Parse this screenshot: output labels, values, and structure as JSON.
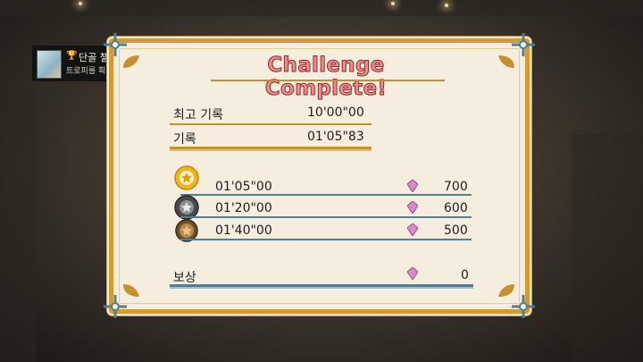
{
  "notification": {
    "trophy_name": "단골 챌린저",
    "message": "트로피를 획득했습니다!",
    "platform_badge": "PS"
  },
  "panel": {
    "title": "Challenge Complete!",
    "best_record": {
      "label": "최고 기록",
      "value": "10'00\"00"
    },
    "record": {
      "label": "기록",
      "value": "01'05\"83"
    },
    "rank_rows": [
      {
        "medal": "gold-medal-icon",
        "time": "01'05\"00",
        "gems": "700"
      },
      {
        "medal": "silver-medal-icon",
        "time": "01'20\"00",
        "gems": "600"
      },
      {
        "medal": "bronze-medal-icon",
        "time": "01'40\"00",
        "gems": "500"
      }
    ],
    "reward": {
      "label": "보상",
      "value": "0"
    }
  },
  "colors": {
    "frame_gold": "#d79a2c",
    "accent_blue": "#4d7f95",
    "title_pink": "#f08a8a",
    "panel_bg": "#f5eedf"
  }
}
